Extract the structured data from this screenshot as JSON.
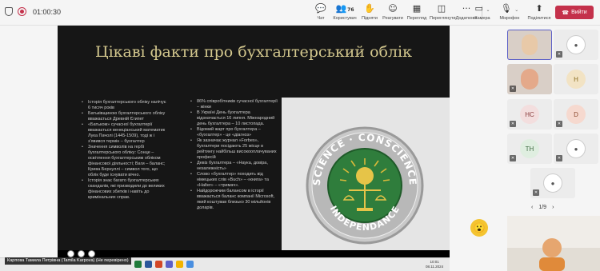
{
  "call": {
    "timer": "01:00:30"
  },
  "toolbar": {
    "items": [
      {
        "label": "Чат",
        "icon": "chat-icon",
        "glyph": "💬"
      },
      {
        "label": "Користувач",
        "icon": "people-icon",
        "glyph": "👥",
        "count": "76"
      },
      {
        "label": "Підняти",
        "icon": "raise-hand-icon",
        "glyph": "✋"
      },
      {
        "label": "Реагувати",
        "icon": "react-icon",
        "glyph": "☺"
      },
      {
        "label": "Перегляд",
        "icon": "view-icon",
        "glyph": "▦"
      },
      {
        "label": "Переглянути",
        "icon": "rooms-icon",
        "glyph": "◫"
      },
      {
        "label": "Додатково",
        "icon": "more-icon",
        "glyph": "···"
      }
    ],
    "camera_label": "Камера",
    "mic_label": "Мікрофон",
    "share_label": "Поділитися",
    "leave_label": "Вийти"
  },
  "slide": {
    "title": "Цікаві факти про бухгалтерський облік",
    "col1": [
      "Історія бухгалтерського обліку налічує 6 тисяч років",
      "Батьківщиною бухгалтерського обліку вважається Древній Єгипет",
      "«Батьком» сучасної бухгалтерії вважається венеціанський математик Лука Пачолі (1445-1509), тоді ж і з'явився термін – бухгалтер",
      "Значення символів на гербі бухгалтерського обліку: Сонце – освітлення бухгалтерським обліком фінансової діяльності; Ваги – баланс; Крива Бернуллі – символ того, що облік буде існувати вічно.",
      "Історія знає багато бухгалтерських скандалів, які призводили до великих фінансових збитків і навіть до кримінальних справ."
    ],
    "col2": [
      "86% співробітників сучасної бухгалтерії – жінки",
      "В Україні День бухгалтера відзначається 16 липня. Міжнародний день бухгалтера – 10 листопада.",
      "Відомий жарт про бухгалтера – «бухгалтер» - це «діагноз»",
      "Як зазначає журнал «Forbes», бухгалтери посідають 25 місце в рейтингу найбільш високооплачуваних професій",
      "Девіз бухгалтера – «Наука, довіра, незалежність»",
      "Слово «бухгалтер» походить від німецьких слів «Buch» – «книга» та «Halter» – «тримач».",
      "Найдорожчим балансом в історії вважається баланс компанії Microsoft, який коштував близько 30 мільйонів доларів."
    ],
    "seal_top": "SCIENCE · CONSCIENCE",
    "seal_bottom": "INDEPENDANCE"
  },
  "presenter": {
    "name": "Карпова Тамила Петрівна (Tamila Karpova) (Не перевірено)"
  },
  "clock": {
    "time": "10:01",
    "date": "08.11.2024"
  },
  "participants": [
    {
      "initials": "",
      "type": "photo",
      "active": true
    },
    {
      "initials": "",
      "type": "avatar",
      "muted": true
    },
    {
      "initials": "",
      "type": "photo",
      "muted": true
    },
    {
      "initials": "H",
      "type": "letter",
      "color": "#f2e3c4",
      "text": "#8a6d1f"
    },
    {
      "initials": "HC",
      "type": "letter",
      "color": "#f3dede",
      "text": "#8a3d3d",
      "muted": true
    },
    {
      "initials": "D",
      "type": "letter",
      "color": "#f6d9cf",
      "text": "#8a4a30",
      "muted": true
    },
    {
      "initials": "TH",
      "type": "letter",
      "color": "#dfeee0",
      "text": "#3d6a40",
      "muted": true
    },
    {
      "initials": "",
      "type": "avatar",
      "muted": true
    },
    {
      "initials": "",
      "type": "avatar",
      "muted": true
    }
  ],
  "pager": {
    "text": "1/9"
  },
  "colors": {
    "accent": "#5b5fc7",
    "leave": "#c4314b",
    "slide_bg": "#161616",
    "slide_title": "#d4c88e",
    "seal_green": "#2f7d3c"
  }
}
